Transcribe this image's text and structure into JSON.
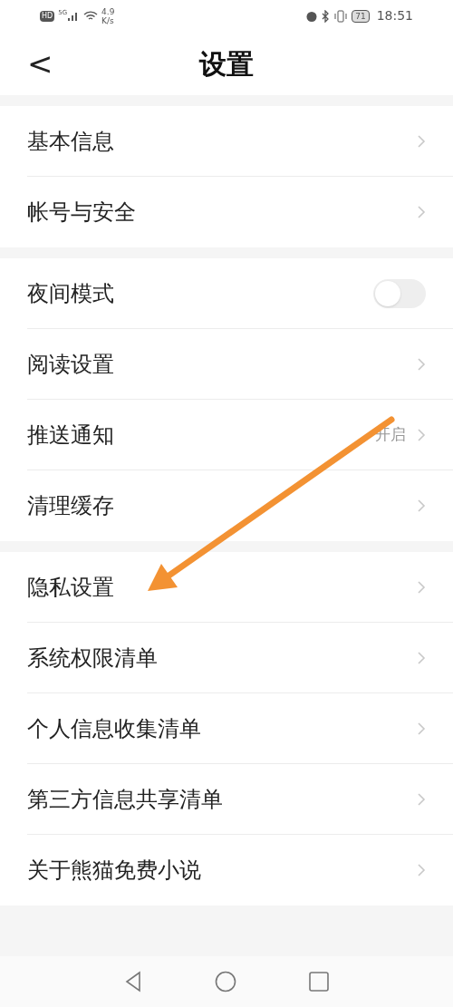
{
  "status_bar": {
    "hd": "HD",
    "network": "5G",
    "speed": "4.9",
    "speed_unit": "K/s",
    "battery": "71",
    "time": "18:51"
  },
  "header": {
    "back": "<",
    "title": "设置"
  },
  "sections": [
    {
      "items": [
        {
          "kind": "link",
          "label": "基本信息"
        },
        {
          "kind": "link",
          "label": "帐号与安全"
        }
      ]
    },
    {
      "items": [
        {
          "kind": "toggle",
          "label": "夜间模式",
          "on": false
        },
        {
          "kind": "link",
          "label": "阅读设置"
        },
        {
          "kind": "link",
          "label": "推送通知",
          "value": "开启"
        },
        {
          "kind": "link",
          "label": "清理缓存"
        }
      ]
    },
    {
      "items": [
        {
          "kind": "link",
          "label": "隐私设置"
        },
        {
          "kind": "link",
          "label": "系统权限清单"
        },
        {
          "kind": "link",
          "label": "个人信息收集清单"
        },
        {
          "kind": "link",
          "label": "第三方信息共享清单"
        },
        {
          "kind": "link",
          "label": "关于熊猫免费小说"
        }
      ]
    }
  ]
}
